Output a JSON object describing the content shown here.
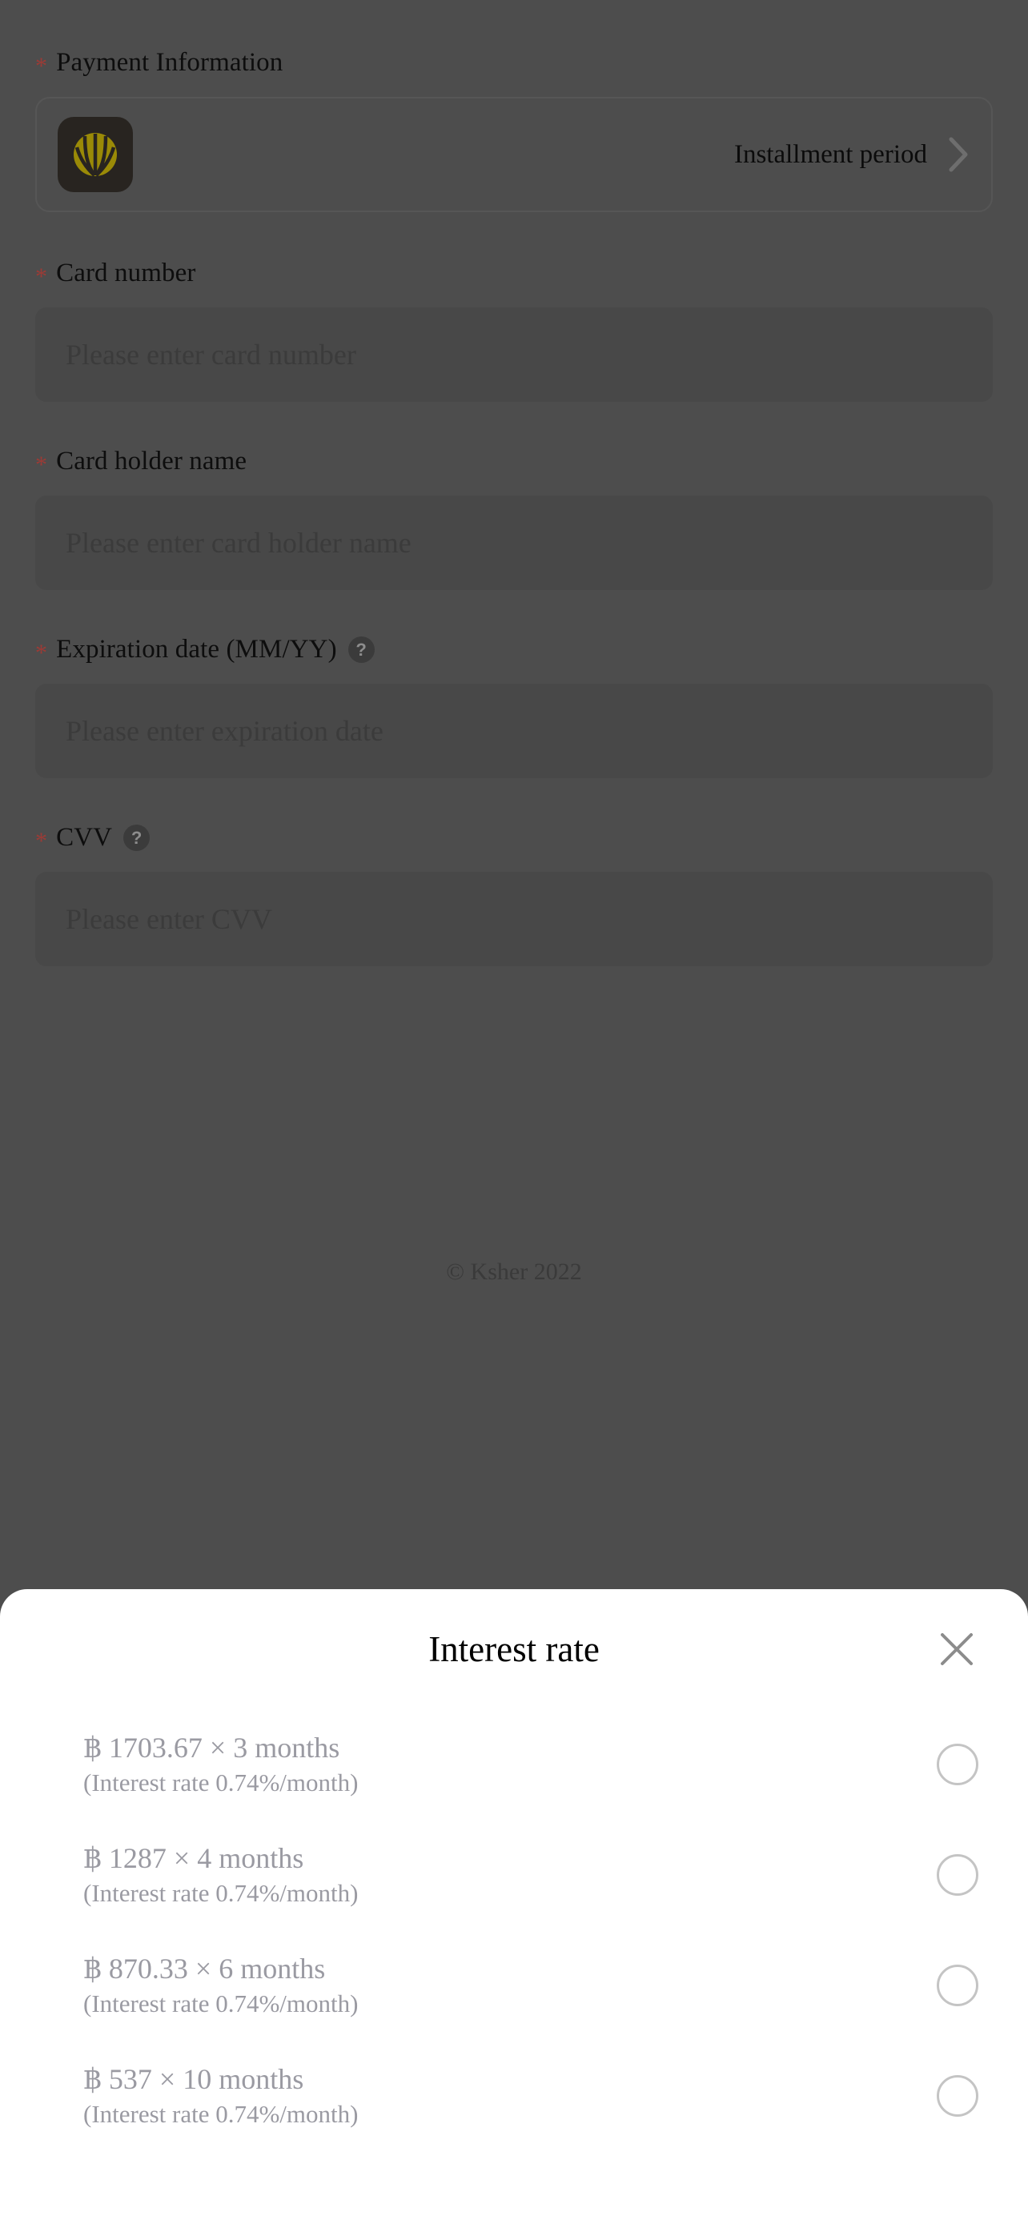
{
  "form": {
    "required_marker": "*",
    "payment_information": {
      "label": "Payment Information",
      "bank_logo_icon": "kbank-logo-icon",
      "installment_label": "Installment period",
      "chevron_icon": "chevron-right-icon"
    },
    "fields": [
      {
        "label": "Card number",
        "placeholder": "Please enter card number",
        "value": "",
        "help": false
      },
      {
        "label": "Card holder name",
        "placeholder": "Please enter card holder name",
        "value": "",
        "help": false
      },
      {
        "label": "Expiration date (MM/YY)",
        "placeholder": "Please enter expiration date",
        "value": "",
        "help": true,
        "help_icon": "question-mark-icon",
        "help_glyph": "?"
      },
      {
        "label": "CVV",
        "placeholder": "Please enter CVV",
        "value": "",
        "help": true,
        "help_icon": "question-mark-icon",
        "help_glyph": "?"
      }
    ],
    "copyright": "© Ksher 2022"
  },
  "sheet": {
    "title": "Interest rate",
    "close_icon": "close-x-icon",
    "options": [
      {
        "main": "฿ 1703.67 × 3 months",
        "sub": "(Interest rate 0.74%/month)",
        "amount": 1703.67,
        "months": 3,
        "rate_percent_per_month": 0.74,
        "selected": false
      },
      {
        "main": "฿ 1287 × 4 months",
        "sub": "(Interest rate 0.74%/month)",
        "amount": 1287,
        "months": 4,
        "rate_percent_per_month": 0.74,
        "selected": false
      },
      {
        "main": "฿ 870.33 × 6 months",
        "sub": "(Interest rate 0.74%/month)",
        "amount": 870.33,
        "months": 6,
        "rate_percent_per_month": 0.74,
        "selected": false
      },
      {
        "main": "฿ 537 × 10 months",
        "sub": "(Interest rate 0.74%/month)",
        "amount": 537,
        "months": 10,
        "rate_percent_per_month": 0.74,
        "selected": false
      }
    ]
  },
  "colors": {
    "scrim": "#4d4d4d",
    "input_bg": "#484848",
    "required_star": "#9b3b36",
    "brand_logo_bg": "#282420",
    "brand_logo_mark": "#9a8a07",
    "sheet_bg": "#ffffff",
    "option_text": "#9a9aa2",
    "radio_border": "#c4c4c4"
  }
}
